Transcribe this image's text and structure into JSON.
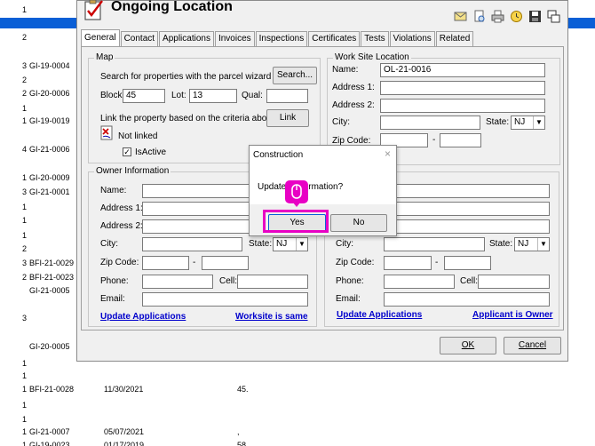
{
  "background_rows": [
    {
      "num": "1",
      "id": "",
      "date": "",
      "amount": ""
    },
    {
      "num": "2",
      "id": "",
      "date": "",
      "amount": ""
    },
    {
      "num": "3",
      "id": "GI-19-0004",
      "date": "",
      "amount": ""
    },
    {
      "num": "2",
      "id": "",
      "date": "",
      "amount": ""
    },
    {
      "num": "2",
      "id": "GI-20-0006",
      "date": "",
      "amount": ""
    },
    {
      "num": "1",
      "id": "",
      "date": "",
      "amount": ""
    },
    {
      "num": "1",
      "id": "GI-19-0019",
      "date": "",
      "amount": ""
    },
    {
      "num": "4",
      "id": "GI-21-0006",
      "date": "",
      "amount": ""
    },
    {
      "num": "1",
      "id": "GI-20-0009",
      "date": "",
      "amount": ""
    },
    {
      "num": "3",
      "id": "GI-21-0001",
      "date": "",
      "amount": ""
    },
    {
      "num": "1",
      "id": "",
      "date": "",
      "amount": ""
    },
    {
      "num": "1",
      "id": "",
      "date": "",
      "amount": ""
    },
    {
      "num": "1",
      "id": "",
      "date": "",
      "amount": ""
    },
    {
      "num": "2",
      "id": "",
      "date": "",
      "amount": ""
    },
    {
      "num": "3",
      "id": "BFI-21-0029",
      "date": "",
      "amount": ""
    },
    {
      "num": "2",
      "id": "BFI-21-0023",
      "date": "",
      "amount": ""
    },
    {
      "num": "",
      "id": "GI-21-0005",
      "date": "",
      "amount": ""
    },
    {
      "num": "3",
      "id": "",
      "date": "",
      "amount": ""
    },
    {
      "num": "",
      "id": "GI-20-0005",
      "date": "",
      "amount": ""
    },
    {
      "num": "1",
      "id": "",
      "date": "",
      "amount": ""
    },
    {
      "num": "1",
      "id": "",
      "date": "",
      "amount": ""
    },
    {
      "num": "1",
      "id": "BFI-21-0028",
      "date": "11/30/2021",
      "amount": "45."
    },
    {
      "num": "1",
      "id": "",
      "date": "",
      "amount": ""
    },
    {
      "num": "1",
      "id": "",
      "date": "",
      "amount": ""
    },
    {
      "num": "1",
      "id": "GI-21-0007",
      "date": "05/07/2021",
      "amount": ","
    },
    {
      "num": "1",
      "id": "GI-19-0023",
      "date": "01/17/2019",
      "amount": "58"
    }
  ],
  "window": {
    "title": "Ongoing Location",
    "toolbar_icons": [
      "envelope-icon",
      "print-preview-icon",
      "printer-icon",
      "clock-icon",
      "save-icon",
      "copy-window-icon"
    ],
    "tabs": [
      "General",
      "Contact",
      "Applications",
      "Invoices",
      "Inspections",
      "Certificates",
      "Tests",
      "Violations",
      "Related"
    ],
    "active_tab": "General"
  },
  "map": {
    "group_title": "Map",
    "search_label": "Search for properties with the parcel wizard",
    "search_button": "Search...",
    "block_label": "Block:",
    "block_value": "45",
    "lot_label": "Lot:",
    "lot_value": "13",
    "qual_label": "Qual:",
    "qual_value": "",
    "link_label": "Link the property based on the criteria above",
    "link_button": "Link",
    "not_linked": "Not linked",
    "isactive_label": "IsActive",
    "isactive_checked": true
  },
  "worksite": {
    "group_title": "Work Site Location",
    "name_label": "Name:",
    "name_value": "OL-21-0016",
    "address1_label": "Address 1:",
    "address2_label": "Address 2:",
    "city_label": "City:",
    "state_label": "State:",
    "state_value": "NJ",
    "zip_label": "Zip Code:",
    "zip_sep": "-"
  },
  "owner": {
    "group_title": "Owner Information",
    "name_label": "Name:",
    "address1_label": "Address 1:",
    "address2_label": "Address 2:",
    "city_label": "City:",
    "state_label": "State:",
    "state_value": "NJ",
    "zip_label": "Zip Code:",
    "zip_sep": "-",
    "phone_label": "Phone:",
    "cell_label": "Cell:",
    "email_label": "Email:",
    "update_link": "Update Applications",
    "same_link": "Worksite is same"
  },
  "applicant": {
    "city_label": "City:",
    "state_label": "State:",
    "state_value": "NJ",
    "zip_label": "Zip Code:",
    "zip_sep": "-",
    "phone_label": "Phone:",
    "cell_label": "Cell:",
    "email_label": "Email:",
    "update_link": "Update Applications",
    "owner_link": "Applicant is Owner"
  },
  "footer": {
    "ok": "OK",
    "cancel": "Cancel"
  },
  "dialog": {
    "title": "Construction",
    "close": "×",
    "message": "Update r information?",
    "yes": "Yes",
    "no": "No"
  },
  "colors": {
    "highlight": "#e800c4",
    "selection": "#0a5fd6",
    "link": "#0000cc"
  }
}
